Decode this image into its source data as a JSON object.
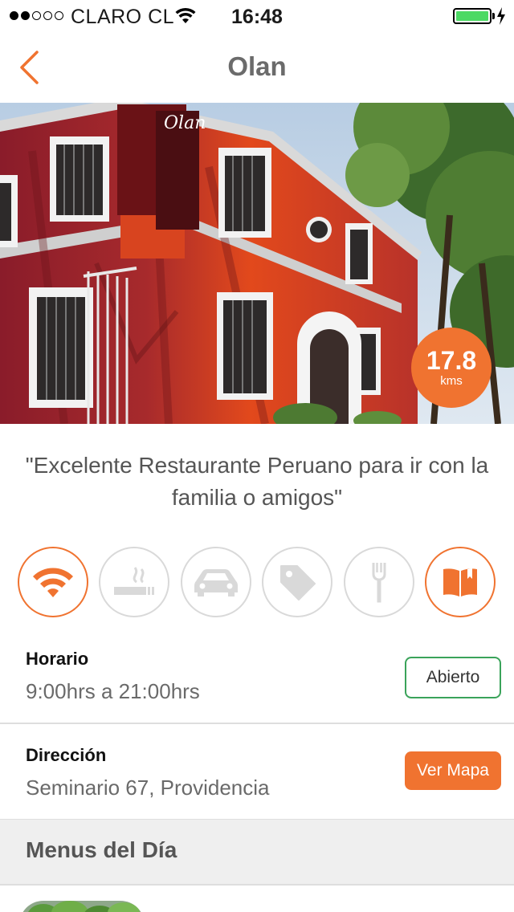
{
  "status_bar": {
    "carrier": "CLARO CL",
    "time": "16:48",
    "battery_level": 1.0,
    "signal_bars": 2
  },
  "nav": {
    "title": "Olan",
    "back_icon": "chevron-left-icon"
  },
  "hero": {
    "distance_value": "17.8",
    "distance_unit": "kms",
    "sign_text": "Olan"
  },
  "quote": "\"Excelente Restaurante Peruano para ir con la familia o amigos\"",
  "amenities": [
    {
      "icon": "wifi-icon",
      "active": true
    },
    {
      "icon": "smoking-icon",
      "active": false
    },
    {
      "icon": "car-icon",
      "active": false
    },
    {
      "icon": "tag-icon",
      "active": false
    },
    {
      "icon": "fork-icon",
      "active": false
    },
    {
      "icon": "book-icon",
      "active": true
    }
  ],
  "schedule": {
    "label": "Horario",
    "value": "9:00hrs a 21:00hrs",
    "status_button": "Abierto"
  },
  "address": {
    "label": "Dirección",
    "value": "Seminario 67, Providencia",
    "map_button": "Ver Mapa"
  },
  "menus": {
    "title": "Menus del Día"
  },
  "colors": {
    "accent": "#f07330",
    "open_green": "#3aa35a",
    "inactive_gray": "#d9d9d9"
  }
}
